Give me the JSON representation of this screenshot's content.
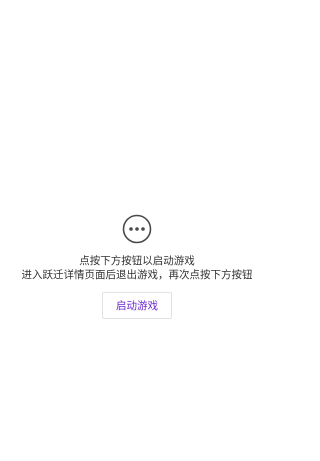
{
  "status": {
    "icon": "more-dots-circle-icon",
    "line1": "点按下方按钮以启动游戏",
    "line2": "进入跃迁详情页面后退出游戏，再次点按下方按钮"
  },
  "start_button": {
    "label": "启动游戏",
    "text_color": "#6a2bd0"
  }
}
